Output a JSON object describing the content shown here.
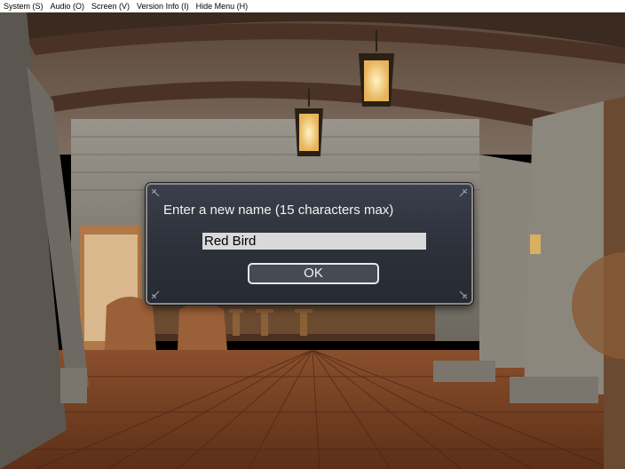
{
  "menu": [
    {
      "label": "System (S)"
    },
    {
      "label": "Audio (O)"
    },
    {
      "label": "Screen (V)"
    },
    {
      "label": "Version Info (I)"
    },
    {
      "label": "Hide Menu (H)"
    }
  ],
  "dialog": {
    "title": "Enter a new name (15 characters max)",
    "input_value": "Red Bird",
    "ok_label": "OK"
  },
  "colors": {
    "dialog_bg": "#2c3039",
    "input_bg": "#d9d9d9",
    "button_border": "#e8e8e8"
  }
}
